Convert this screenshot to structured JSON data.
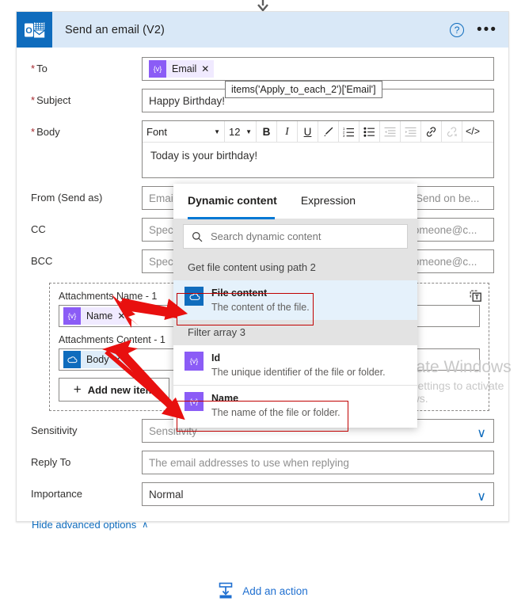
{
  "header": {
    "title": "Send an email (V2)",
    "icon": "outlook-icon",
    "help_label": "?",
    "more_label": "•••"
  },
  "tooltip": {
    "text": "items('Apply_to_each_2')['Email']"
  },
  "fields": {
    "to": {
      "label": "To",
      "required": true,
      "token": {
        "label": "Email",
        "icon": "expression-icon",
        "remove": "✕"
      }
    },
    "subject": {
      "label": "Subject",
      "required": true,
      "value": "Happy Birthday!"
    },
    "body": {
      "label": "Body",
      "required": true,
      "content": "Today is your birthday!",
      "toolbar": {
        "font_name": "Font",
        "font_size": "12",
        "bold": "B",
        "italic": "I",
        "underline": "U",
        "highlight": "✎",
        "numbered_list": "☷",
        "bulleted_list": "☰",
        "indent_increase": "⇥",
        "indent_decrease": "⇤",
        "insert_link": "🔗",
        "remove_link": "🔗",
        "code_view": "</>"
      }
    },
    "from": {
      "label": "From (Send as)",
      "placeholder": "Email address to send mail from (requires \"Send as\" or \"Send on be..."
    },
    "cc": {
      "label": "CC",
      "placeholder": "Specify email addresses separated by semicolons like someone@c..."
    },
    "bcc": {
      "label": "BCC",
      "placeholder": "Specify email addresses separated by semicolons like someone@c..."
    },
    "sensitivity": {
      "label": "Sensitivity",
      "placeholder": "Sensitivity",
      "chevron": "∨"
    },
    "reply_to": {
      "label": "Reply To",
      "placeholder": "The email addresses to use when replying"
    },
    "importance": {
      "label": "Importance",
      "value": "Normal",
      "chevron": "∨"
    }
  },
  "attachments": {
    "name_label": "Attachments Name - 1",
    "name_token": {
      "label": "Name",
      "icon": "expression-icon",
      "remove": "✕"
    },
    "content_label": "Attachments Content - 1",
    "content_token": {
      "label": "Body",
      "icon": "onedrive-icon",
      "remove": "✕"
    },
    "add_new_label": "Add new item",
    "add_new_icon": "plus-icon",
    "text_mode_icon": "switch-to-text-mode-icon"
  },
  "advanced": {
    "hide_label": "Hide advanced options",
    "chevron": "∧"
  },
  "dynamic_content": {
    "tabs": [
      {
        "label": "Dynamic content",
        "active": true
      },
      {
        "label": "Expression",
        "active": false
      }
    ],
    "search_placeholder": "Search dynamic content",
    "search_icon": "search-icon",
    "groups": [
      {
        "title": "Get file content using path 2",
        "items": [
          {
            "name": "File content",
            "desc": "The content of the file.",
            "icon": "onedrive-icon",
            "icon_color": "blue",
            "selected": true,
            "highlighted": true
          }
        ]
      },
      {
        "title": "Filter array 3",
        "items": [
          {
            "name": "Id",
            "desc": "The unique identifier of the file or folder.",
            "icon": "expression-icon",
            "icon_color": "purple",
            "selected": false,
            "highlighted": false
          },
          {
            "name": "Name",
            "desc": "The name of the file or folder.",
            "icon": "expression-icon",
            "icon_color": "purple",
            "selected": false,
            "highlighted": true
          }
        ]
      }
    ]
  },
  "watermark": {
    "line1": "Activate Windows",
    "line2": "Go to Settings to activate Windows."
  },
  "footer": {
    "add_action_label": "Add an action",
    "add_action_icon": "insert-action-icon"
  },
  "colors": {
    "header_bg": "#d9e8f7",
    "brand_blue": "#0f6cbd",
    "accent_blue": "#0078d4",
    "link_blue": "#1f6fd0",
    "required_red": "#a4262c",
    "annotation_red": "#e8100f",
    "purple_token": "#8b5cf6",
    "highlight_border": "#c00000"
  }
}
